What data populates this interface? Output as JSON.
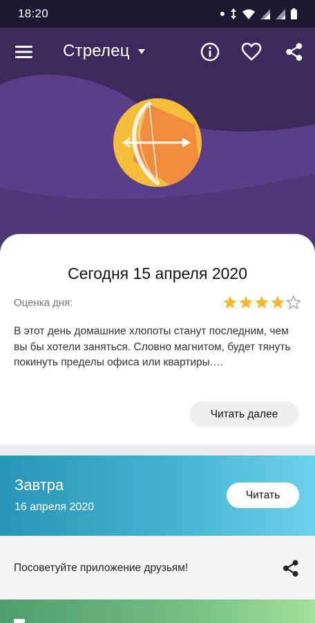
{
  "status_bar": {
    "time": "18:20",
    "icons": [
      "notification-dot-icon",
      "data-arrows-icon",
      "wifi-icon",
      "signal-icon",
      "signal-icon",
      "battery-icon"
    ]
  },
  "app_bar": {
    "title": "Стрелец",
    "icons": [
      "menu-icon",
      "dropdown-caret-icon",
      "info-icon",
      "heart-icon",
      "share-icon"
    ]
  },
  "sign": {
    "icon": "sagittarius-bow-icon",
    "circle_color": "#f4bd3a",
    "arrow_color": "#ef8c3d"
  },
  "today": {
    "title": "Сегодня 15 апреля 2020",
    "rating_label": "Оценка дня:",
    "rating": 4,
    "rating_max": 5,
    "forecast": "В этот день домашние хлопоты станут последним, чем вы бы хотели заняться. Словно магнитом, будет тянуть покинуть пределы офиса или квартиры.…",
    "read_more_label": "Читать далее"
  },
  "tomorrow": {
    "title": "Завтра",
    "date": "16 апреля 2020",
    "read_label": "Читать"
  },
  "share": {
    "text": "Посоветуйте приложение друзьям!",
    "icon": "share-icon"
  },
  "colors": {
    "header_bg": "#3d2a5c",
    "status_bg": "#1d1833",
    "star_color": "#f5b824",
    "tomorrow_gradient": [
      "#2a95b6",
      "#6ed0ea"
    ],
    "green_gradient": [
      "#4e9d6e",
      "#a2e09a"
    ]
  }
}
